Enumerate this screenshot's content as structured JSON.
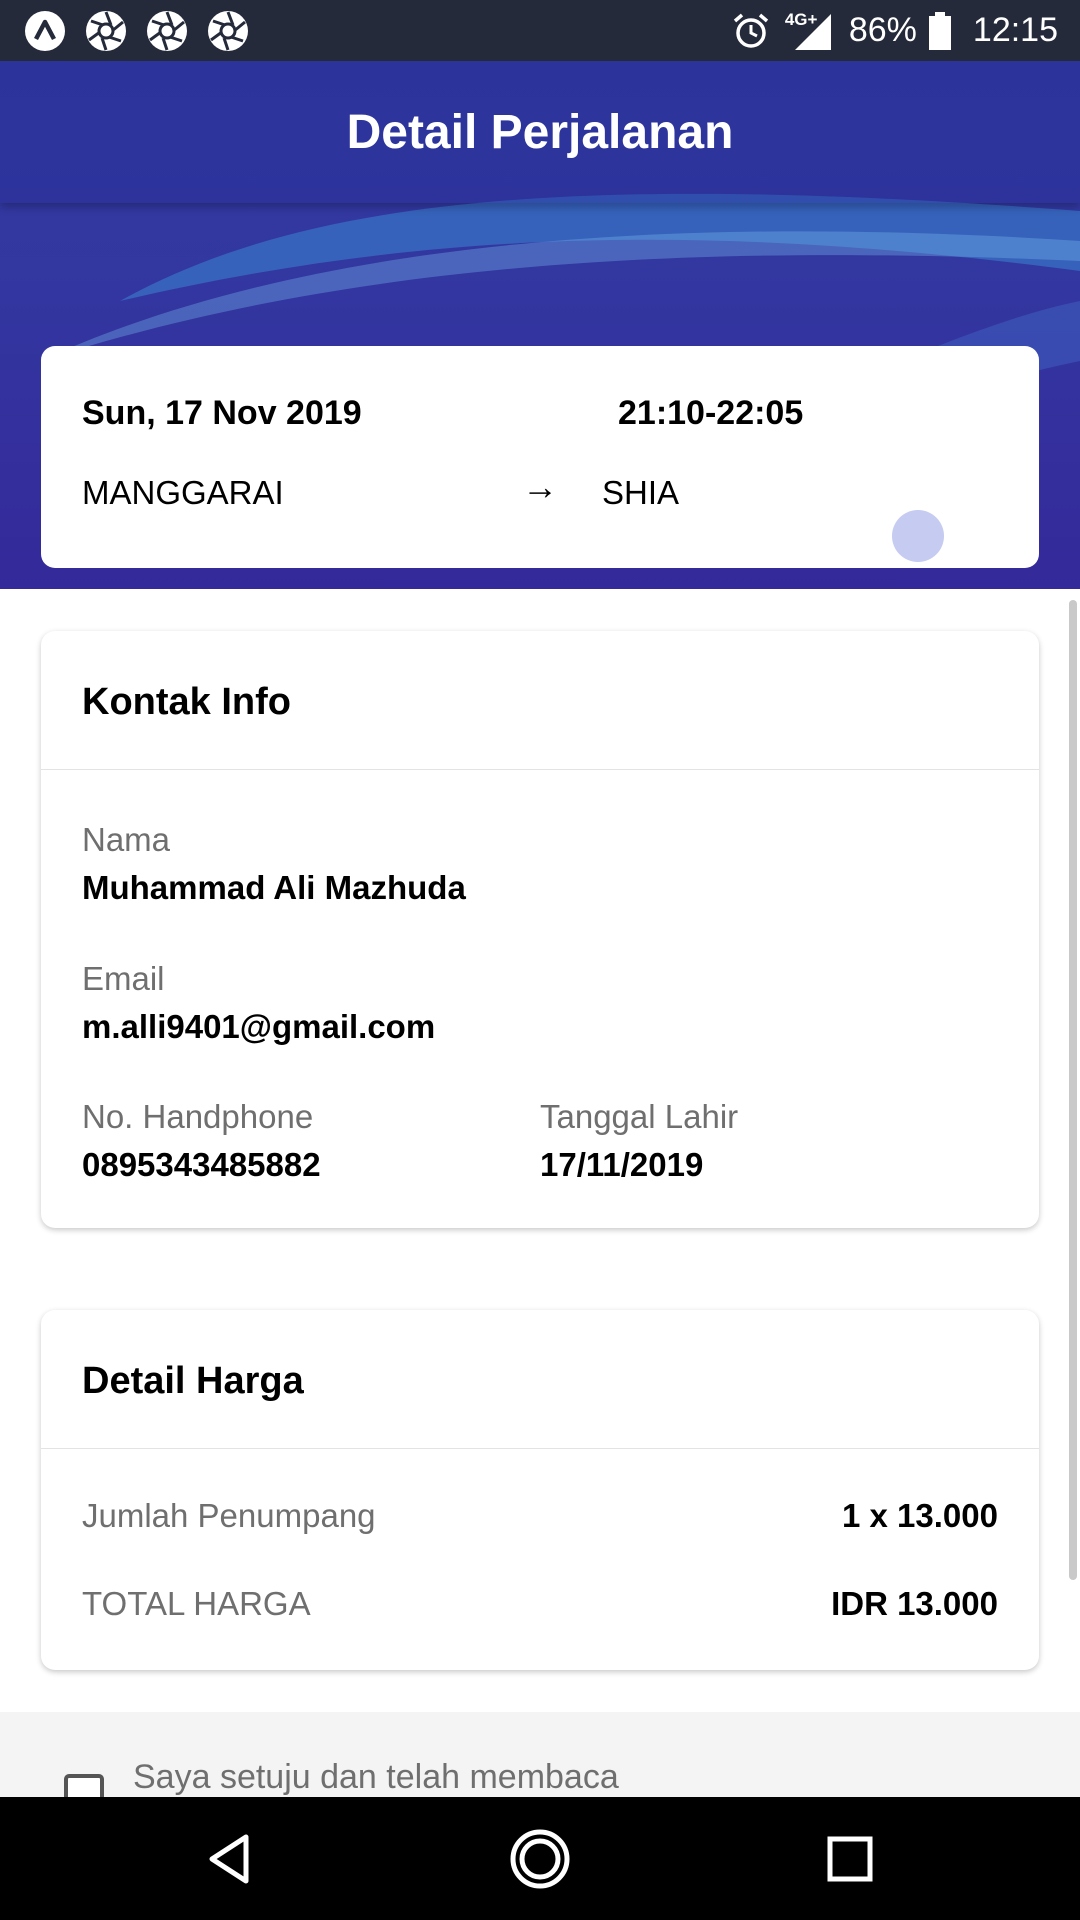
{
  "status_bar": {
    "network": "4G+",
    "battery": "86%",
    "time": "12:15",
    "icons": [
      "app-a-icon",
      "aperture-icon",
      "aperture-icon",
      "aperture-icon",
      "alarm-icon",
      "signal-icon",
      "battery-icon"
    ]
  },
  "header": {
    "title": "Detail Perjalanan"
  },
  "trip": {
    "date": "Sun, 17 Nov 2019",
    "time": "21:10-22:05",
    "origin": "MANGGARAI",
    "arrow": "→",
    "destination": "SHIA"
  },
  "contact": {
    "title": "Kontak Info",
    "name_label": "Nama",
    "name_value": "Muhammad Ali Mazhuda",
    "email_label": "Email",
    "email_value": "m.alli9401@gmail.com",
    "phone_label": "No. Handphone",
    "phone_value": "0895343485882",
    "birth_label": "Tanggal Lahir",
    "birth_value": "17/11/2019"
  },
  "price": {
    "title": "Detail Harga",
    "passenger_label": "Jumlah Penumpang",
    "passenger_value": "1 x 13.000",
    "total_label": "TOTAL HARGA",
    "total_value": "IDR 13.000"
  },
  "agreement": {
    "text": "Saya setuju dan telah membaca",
    "checked": false
  },
  "colors": {
    "header_primary": "#3337a0",
    "status_bar": "#242a3a",
    "label_gray": "#6f6f6f"
  }
}
